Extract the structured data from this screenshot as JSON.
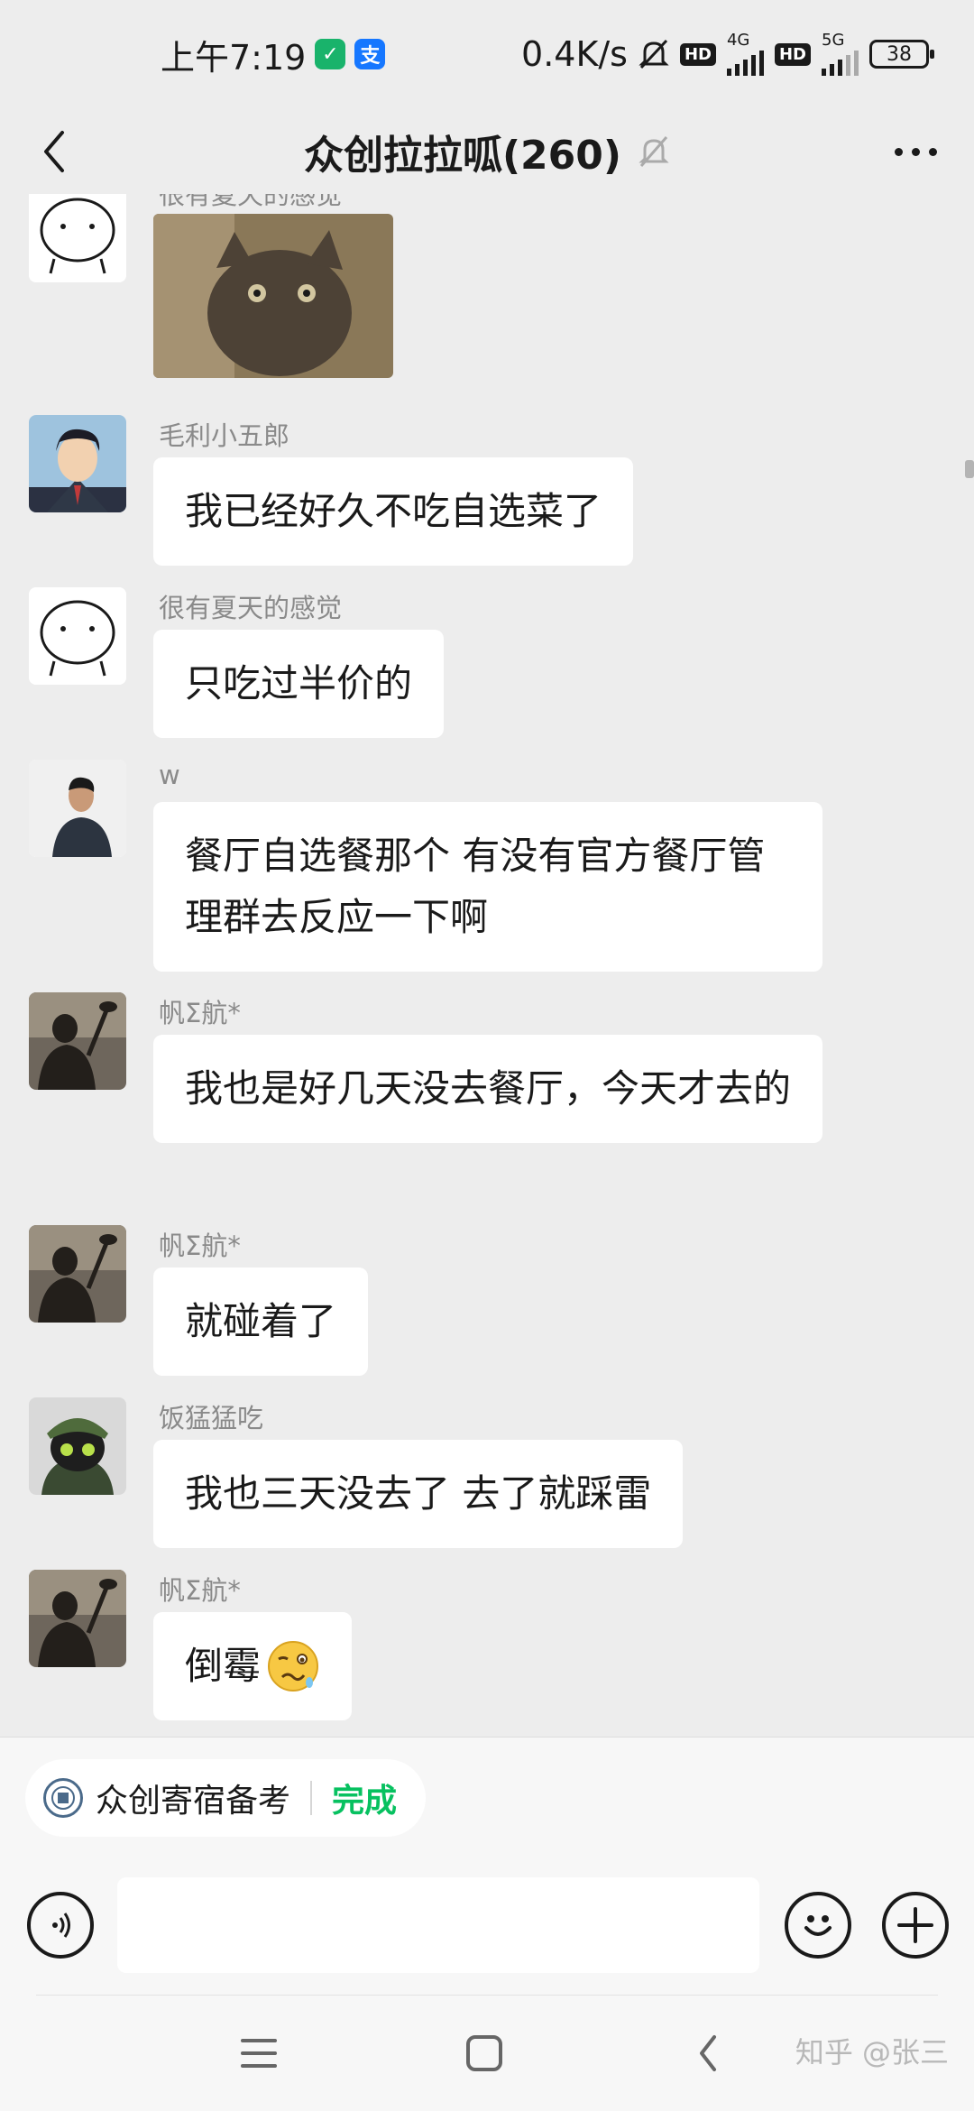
{
  "status_bar": {
    "time": "上午7:19",
    "net_speed": "0.4K/s",
    "hd1": "HD",
    "net1": "4G",
    "hd2": "HD",
    "net2": "5G",
    "battery": "38"
  },
  "header": {
    "title": "众创拉拉呱(260)"
  },
  "messages": [
    {
      "sender": "很有夏天的感觉",
      "type": "sticker",
      "avatar": "face-avatar"
    },
    {
      "sender": "毛利小五郎",
      "text": "我已经好久不吃自选菜了",
      "avatar": "anime-man-avatar"
    },
    {
      "sender": "很有夏天的感觉",
      "text": "只吃过半价的",
      "avatar": "face-avatar"
    },
    {
      "sender": "w",
      "text": "餐厅自选餐那个 有没有官方餐厅管理群去反应一下啊",
      "avatar": "person-photo-avatar"
    },
    {
      "sender": "帆Σ航*",
      "text": "我也是好几天没去餐厅，今天才去的",
      "avatar": "silhouette-avatar"
    },
    {
      "sender": "帆Σ航*",
      "text": "就碰着了",
      "avatar": "silhouette-avatar"
    },
    {
      "sender": "饭猛猛吃",
      "text": "我也三天没去了 去了就踩雷",
      "avatar": "cat-soldier-avatar"
    },
    {
      "sender": "帆Σ航*",
      "text": "倒霉",
      "avatar": "silhouette-avatar",
      "emoji": "woozy-face"
    }
  ],
  "shortcut_chip": {
    "label": "众创寄宿备考",
    "action": "完成"
  },
  "input": {
    "placeholder": ""
  },
  "watermark": "知乎 @张三",
  "colors": {
    "background": "#ededed",
    "bubble": "#ffffff",
    "accent_green": "#07c160",
    "sender_gray": "#8a8a8a"
  }
}
